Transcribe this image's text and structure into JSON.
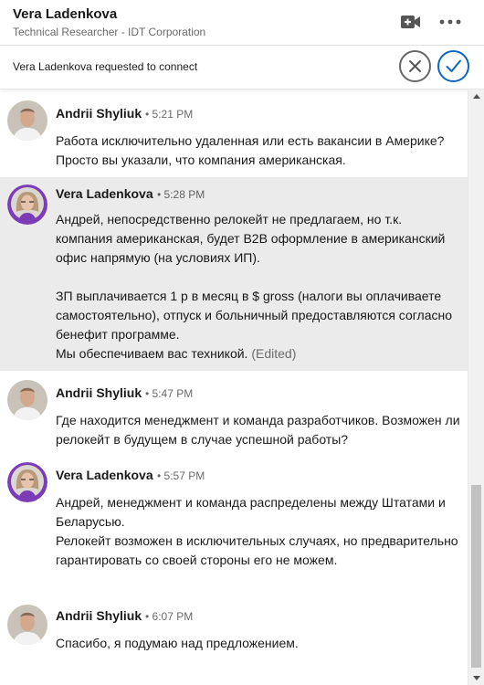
{
  "header": {
    "name": "Vera Ladenkova",
    "subtitle": "Technical Researcher - IDT Corporation",
    "video_icon": "video-call-icon",
    "more_icon": "more-options-icon"
  },
  "request": {
    "name": "Vera Ladenkova",
    "text": " requested to connect",
    "decline_icon": "close-icon",
    "accept_icon": "checkmark-icon"
  },
  "messages": [
    {
      "sender": "Andrii Shyliuk",
      "time": "• 5:21 PM",
      "text": "Работа исключительно удаленная или есть вакансии в Америке? Просто вы указали, что компания американская.",
      "edited": ""
    },
    {
      "sender": "Vera Ladenkova",
      "time": "• 5:28 PM",
      "text": "Андрей, непосредственно релокейт не предлагаем, но т.к. компания американская, будет B2B оформление в американский офис напрямую (на условиях ИП).\n\nЗП выплачивается 1 р в месяц в $ gross (налоги вы оплачиваете самостоятельно), отпуск и больничный предоставляются согласно бенефит программе.\nМы обеспечиваем вас техникой.",
      "edited": " (Edited)"
    },
    {
      "sender": "Andrii Shyliuk",
      "time": "• 5:47 PM",
      "text": "Где находится менеджмент и команда разработчиков. Возможен ли релокейт в будущем в случае успешной работы?",
      "edited": ""
    },
    {
      "sender": "Vera Ladenkova",
      "time": "• 5:57 PM",
      "text": "Андрей, менеджмент и команда распределены между Штатами и Беларусью.\nРелокейт возможен в исключительных случаях, но предварительно гарантировать со своей стороны его не можем.",
      "edited": ""
    },
    {
      "sender": "Andrii Shyliuk",
      "time": "• 6:07 PM",
      "text": "Спасибо, я подумаю над предложением.",
      "edited": ""
    }
  ],
  "colors": {
    "accent": "#0a66c2",
    "highlight_bg": "#ebebeb",
    "avatar_ring": "#7c3bb7"
  }
}
